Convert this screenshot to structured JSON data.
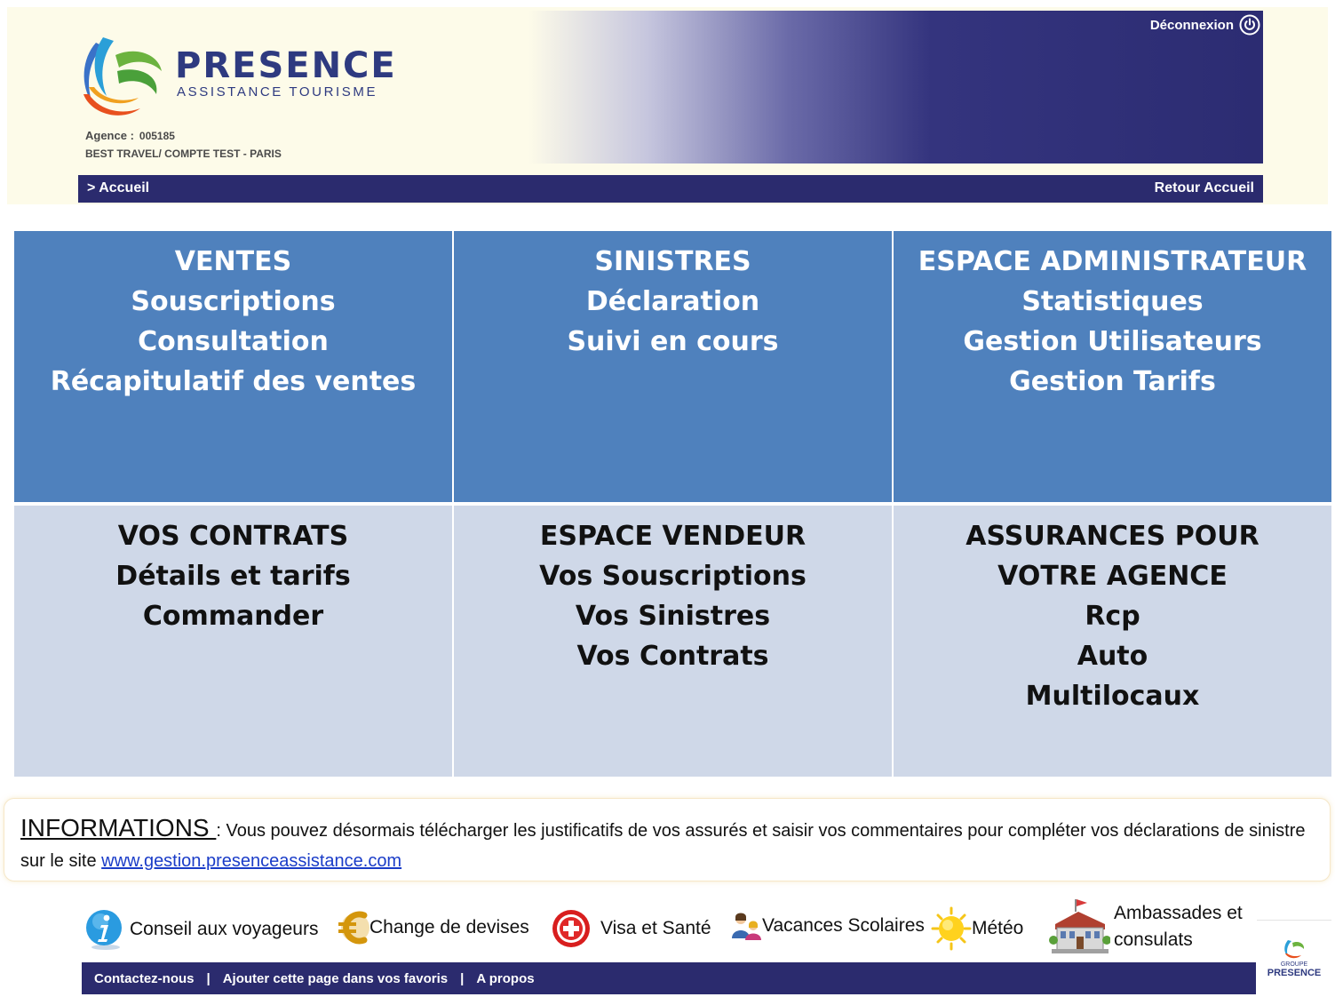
{
  "header": {
    "logo_title": "PRESENCE",
    "logo_subtitle": "ASSISTANCE TOURISME",
    "agency_label": "Agence :",
    "agency_code": "005185",
    "agency_name": "BEST TRAVEL/ COMPTE TEST - PARIS",
    "logout_label": "Déconnexion"
  },
  "nav": {
    "breadcrumb": "> Accueil",
    "home_link": "Retour Accueil"
  },
  "grid": [
    {
      "title": "VENTES",
      "items": [
        "Souscriptions",
        "Consultation",
        "Récapitulatif des ventes"
      ]
    },
    {
      "title": "SINISTRES",
      "items": [
        "Déclaration",
        "Suivi en cours"
      ]
    },
    {
      "title": "ESPACE ADMINISTRATEUR",
      "items": [
        "Statistiques",
        "Gestion Utilisateurs",
        "Gestion Tarifs"
      ]
    },
    {
      "title": "VOS CONTRATS",
      "items": [
        "Détails et tarifs",
        "Commander"
      ]
    },
    {
      "title": "ESPACE VENDEUR",
      "items": [
        "Vos Souscriptions",
        "Vos Sinistres",
        "Vos Contrats"
      ]
    },
    {
      "title": "ASSURANCES POUR  VOTRE AGENCE",
      "items": [
        "Rcp",
        "Auto",
        "Multilocaux"
      ]
    }
  ],
  "info": {
    "title": "INFORMATIONS ",
    "text": " : Vous pouvez désormais télécharger les justificatifs de vos assurés et saisir vos commentaires pour compléter vos déclarations de sinistre  sur le site   ",
    "link": "www.gestion.presenceassistance.com"
  },
  "tools": {
    "conseil": "Conseil aux voyageurs",
    "change": "Change de devises",
    "visa": "Visa et Santé",
    "vacances": "Vacances Scolaires",
    "meteo": "Météo",
    "ambassades_line1": "Ambassades et",
    "ambassades_line2": "consulats"
  },
  "footer": {
    "contact": "Contactez-nous",
    "favoris": "Ajouter cette page dans vos favoris",
    "apropos": "A propos",
    "separator": "|",
    "groupe_line1": "GROUPE",
    "groupe_line2": "PRESENCE"
  },
  "colors": {
    "navy": "#2b2b6e",
    "tile_blue": "#4f81bd",
    "tile_light": "#cfd8e8",
    "link_blue": "#1a3cc8"
  },
  "icons": [
    "logo-swirl-icon",
    "power-icon",
    "info-icon",
    "euro-icon",
    "medical-cross-icon",
    "family-icon",
    "sun-icon",
    "building-icon"
  ]
}
